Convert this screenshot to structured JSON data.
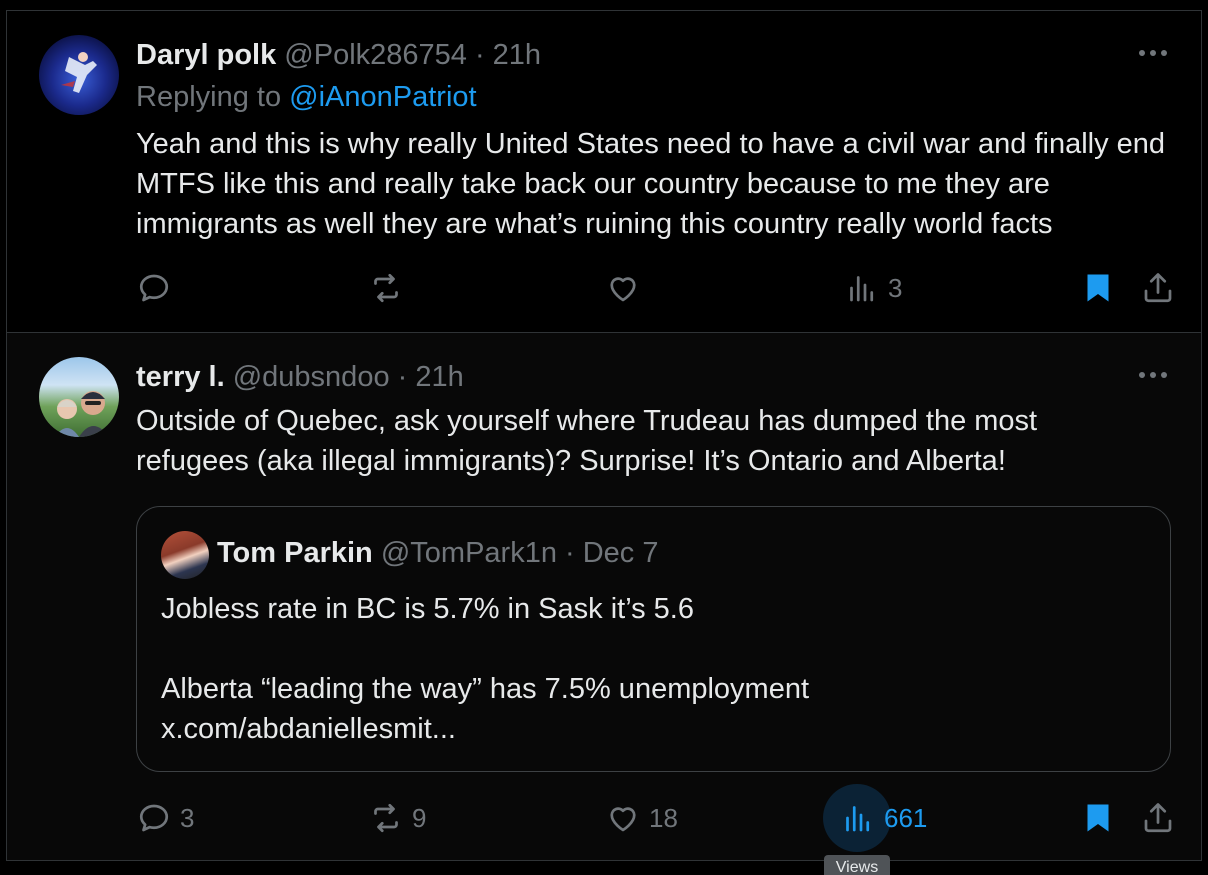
{
  "tweet1": {
    "name": "Daryl polk",
    "handle": "@Polk286754 · 21h",
    "replying_prefix": "Replying to ",
    "replying_handle": "@iAnonPatriot",
    "text": "Yeah and this is why really United States need to have a civil war and finally end MTFS like this and really take back our country because to me they are immigrants as well they are what’s ruining this country really world facts",
    "more": "···",
    "actions": {
      "reply_count": "",
      "repost_count": "",
      "like_count": "",
      "views_count": "3"
    }
  },
  "tweet2": {
    "name": "terry l.",
    "handle": "@dubsndoo · 21h",
    "text": "Outside of Quebec, ask yourself where Trudeau has dumped the most refugees (aka illegal immigrants)? Surprise! It’s Ontario and Alberta!",
    "more": "···",
    "quote": {
      "name": "Tom Parkin",
      "handle": "@TomPark1n · Dec 7",
      "line1": "Jobless rate in BC is 5.7% in Sask it’s 5.6",
      "line2": "Alberta “leading the way” has 7.5% unemployment",
      "line3": "x.com/abdaniellesmit..."
    },
    "actions": {
      "reply_count": "3",
      "repost_count": "9",
      "like_count": "18",
      "views_count": "661"
    },
    "tooltip": "Views"
  },
  "colors": {
    "background": "#000000",
    "text": "#e7e9ea",
    "muted": "#71767b",
    "accent": "#1d9bf0",
    "border": "#2f3336"
  },
  "icons": [
    "reply-icon",
    "repost-icon",
    "like-icon",
    "views-icon",
    "bookmark-icon",
    "share-icon",
    "more-icon"
  ]
}
